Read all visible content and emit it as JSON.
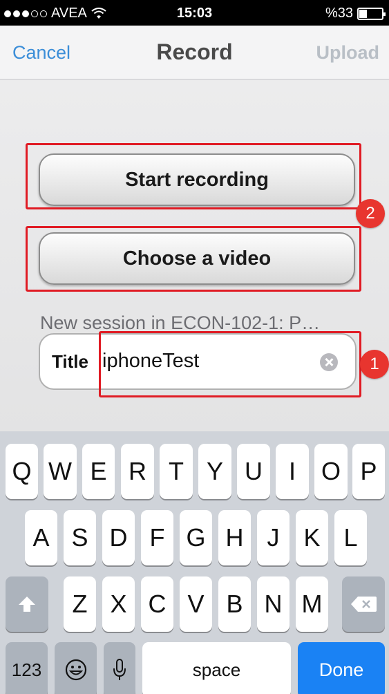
{
  "status": {
    "carrier": "AVEA",
    "time": "15:03",
    "battery": "%33",
    "battery_level": 0.33,
    "signal_bars": 3,
    "signal_total": 5
  },
  "nav": {
    "cancel": "Cancel",
    "title": "Record",
    "upload": "Upload"
  },
  "buttons": {
    "start_recording": "Start recording",
    "choose_video": "Choose a video"
  },
  "session_label": "New session in ECON-102-1: P…",
  "title_field": {
    "label": "Title",
    "value": "iphoneTest"
  },
  "annotations": {
    "badge_title": "1",
    "badge_buttons": "2",
    "highlight_color": "#e01b24"
  },
  "keyboard": {
    "row1": [
      "Q",
      "W",
      "E",
      "R",
      "T",
      "Y",
      "U",
      "I",
      "O",
      "P"
    ],
    "row2": [
      "A",
      "S",
      "D",
      "F",
      "G",
      "H",
      "J",
      "K",
      "L"
    ],
    "row3": [
      "Z",
      "X",
      "C",
      "V",
      "B",
      "N",
      "M"
    ],
    "numbers_key": "123",
    "space_key": "space",
    "done_key": "Done"
  },
  "colors": {
    "accent": "#3c8ed8",
    "done_key": "#1a82f4",
    "badge": "#e8352f"
  }
}
